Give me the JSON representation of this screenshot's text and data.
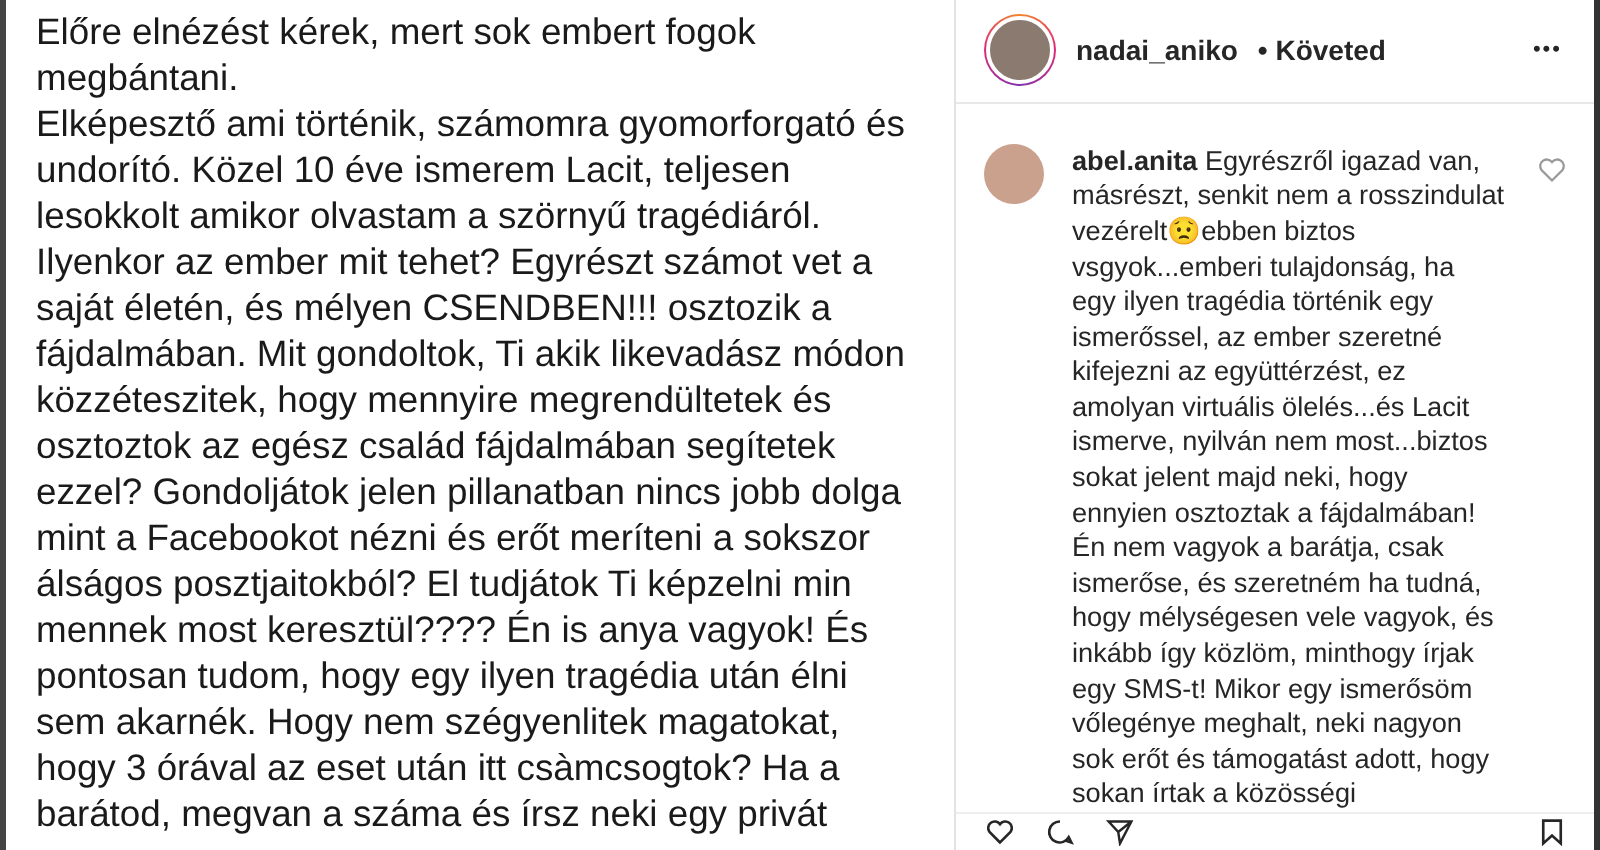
{
  "post": {
    "lines": [
      "Előre elnézést kérek, mert sok embert fogok",
      "megbántani.",
      "Elképesztő ami történik, számomra gyomorforgató és",
      "undorító. Közel 10 éve ismerem Lacit, teljesen",
      "lesokkolt amikor olvastam a szörnyű tragédiáról.",
      "Ilyenkor az ember mit tehet? Egyrészt számot vet a",
      "saját életén, és mélyen CSENDBEN!!! osztozik a",
      "fájdalmában. Mit gondoltok, Ti akik likevadász módon",
      "közzéteszitek, hogy mennyire megrendültetek és",
      "osztoztok az egész család fájdalmában segítetek",
      "ezzel? Gondoljátok jelen pillanatban nincs jobb dolga",
      "mint a Facebookot nézni és erőt meríteni a sokszor",
      "álságos posztjaitokból? El tudjátok Ti képzelni min",
      "mennek most keresztül???? Én is anya vagyok! És",
      "pontosan tudom, hogy egy ilyen tragédia után élni",
      "sem akarnék. Hogy nem szégyenlitek magatokat,",
      "hogy 3 órával az eset után itt csàmcsogtok? Ha a",
      "barátod, megvan a száma és írsz neki egy privát"
    ]
  },
  "header": {
    "username": "nadai_aniko",
    "follow_status": "• Követed",
    "more": "•••"
  },
  "comment": {
    "lines": [
      "**abel.anita** Egyrészről igazad van,",
      "másrészt, senkit nem a rosszindulat",
      "vezérelt😟ebben biztos",
      "vsgyok...emberi tulajdonság, ha",
      "egy ilyen tragédia történik egy",
      "ismerőssel, az ember szeretné",
      "kifejezni az együttérzést, ez",
      "amolyan virtuális ölelés...és Lacit",
      "ismerve, nyilván nem most...biztos",
      "sokat jelent majd neki, hogy",
      "ennyien osztoztak a fájdalmában!",
      "Én nem vagyok a barátja, csak",
      "ismerőse, és szeretném ha tudná,",
      "hogy mélységesen vele vagyok, és",
      "inkább így közlöm, minthogy írjak",
      "egy SMS-t! Mikor egy ismerősöm",
      "vőlegénye meghalt, neki nagyon",
      "sok erőt és támogatást adott, hogy",
      "sokan írtak a közösségi"
    ],
    "liked": false
  }
}
